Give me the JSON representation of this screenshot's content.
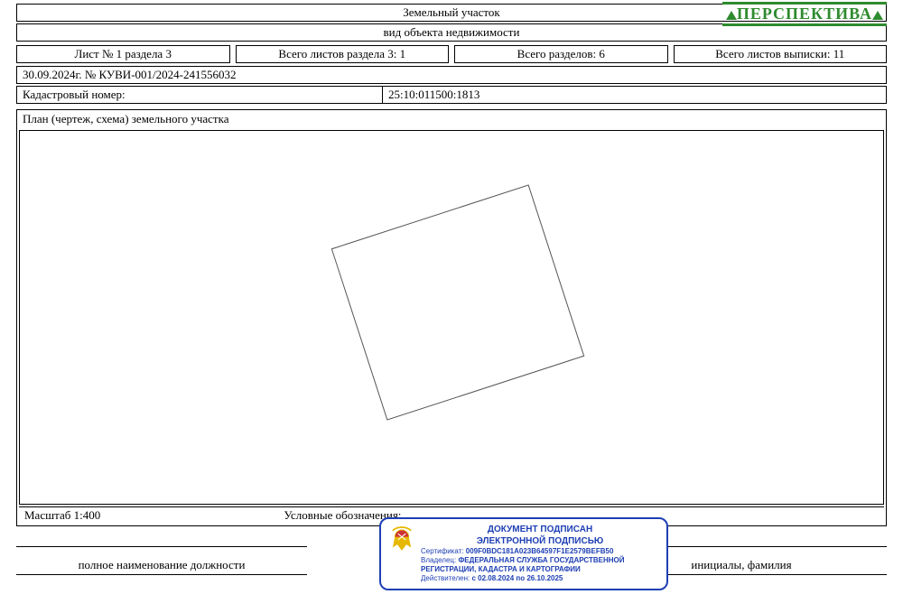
{
  "logo": "ПЕРСПЕКТИВА",
  "header": {
    "object_type": "Земельный участок",
    "object_kind": "вид объекта недвижимости"
  },
  "meta": {
    "sheet": "Лист № 1 раздела 3",
    "sheets_section": "Всего листов раздела 3: 1",
    "sections_total": "Всего разделов: 6",
    "sheets_total": "Всего листов выписки: 11",
    "doc_number": "30.09.2024г. № КУВИ-001/2024-241556032",
    "cadastral_label": "Кадастровый номер:",
    "cadastral_number": "25:10:011500:1813"
  },
  "plan": {
    "title": "План (чертеж, схема) земельного участка",
    "scale_label": "Масштаб 1:400",
    "legend_label": "Условные обозначения:"
  },
  "signatures": {
    "position": "полное наименование должности",
    "initials": "инициалы, фамилия"
  },
  "stamp": {
    "line1": "ДОКУМЕНТ ПОДПИСАН",
    "line2": "ЭЛЕКТРОННОЙ ПОДПИСЬЮ",
    "cert_label": "Сертификат:",
    "cert": "009F0BDC181A023B64597F1E2579BEFB50",
    "owner_label": "Владелец:",
    "owner": "ФЕДЕРАЛЬНАЯ СЛУЖБА ГОСУДАРСТВЕННОЙ",
    "owner2": "РЕГИСТРАЦИИ, КАДАСТРА И КАРТОГРАФИИ",
    "valid_label": "Действителен:",
    "valid": "с 02.08.2024 по 26.10.2025"
  }
}
